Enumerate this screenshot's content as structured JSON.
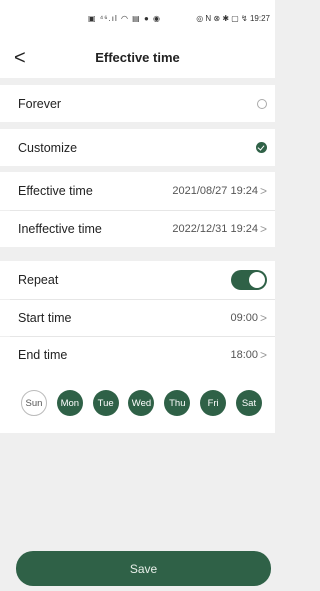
{
  "status_bar": {
    "left": "▣ ⁴⁶.ıl ◠ ▤ ● ◉",
    "right": "◎ N ⊗ ✱ ▢ ↯ 19:27"
  },
  "header": {
    "back_glyph": "<",
    "title": "Effective time"
  },
  "mode": {
    "forever_label": "Forever",
    "customize_label": "Customize",
    "selected": "Customize"
  },
  "period": {
    "effective_label": "Effective time",
    "effective_value": "2021/08/27 19:24",
    "ineffective_label": "Ineffective time",
    "ineffective_value": "2022/12/31 19:24"
  },
  "repeat": {
    "label": "Repeat",
    "enabled": true,
    "start_label": "Start time",
    "start_value": "09:00",
    "end_label": "End time",
    "end_value": "18:00"
  },
  "weekdays": [
    {
      "label": "Sun",
      "selected": false
    },
    {
      "label": "Mon",
      "selected": true
    },
    {
      "label": "Tue",
      "selected": true
    },
    {
      "label": "Wed",
      "selected": true
    },
    {
      "label": "Thu",
      "selected": true
    },
    {
      "label": "Fri",
      "selected": true
    },
    {
      "label": "Sat",
      "selected": true
    }
  ],
  "chevron_glyph": ">",
  "save_label": "Save",
  "colors": {
    "accent": "#2f6147",
    "background": "#efefef"
  }
}
